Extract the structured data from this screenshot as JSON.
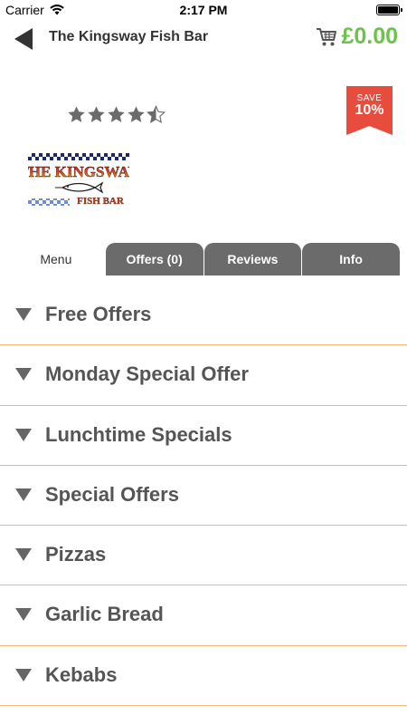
{
  "status_bar": {
    "carrier": "Carrier",
    "time": "2:17 PM"
  },
  "header": {
    "title": "The Kingsway Fish Bar",
    "cart_total": "£0.00"
  },
  "rating": {
    "value": 4.5,
    "max": 5
  },
  "save_badge": {
    "label": "SAVE",
    "percent": "10%"
  },
  "logo": {
    "line1": "THE KINGSWAY",
    "line2": "FISH BAR"
  },
  "tabs": [
    {
      "label": "Menu",
      "active": true
    },
    {
      "label": "Offers (0)",
      "active": false
    },
    {
      "label": "Reviews",
      "active": false
    },
    {
      "label": "Info",
      "active": false
    }
  ],
  "categories": [
    "Free Offers",
    "Monday Special Offer",
    "Lunchtime Specials",
    "Special Offers",
    "Pizzas",
    "Garlic Bread",
    "Kebabs"
  ],
  "colors": {
    "accent_green": "#6cc24a",
    "badge_red": "#e84c3d",
    "tab_gray": "#6b6b6b",
    "divider_orange": "#f4b97a"
  }
}
